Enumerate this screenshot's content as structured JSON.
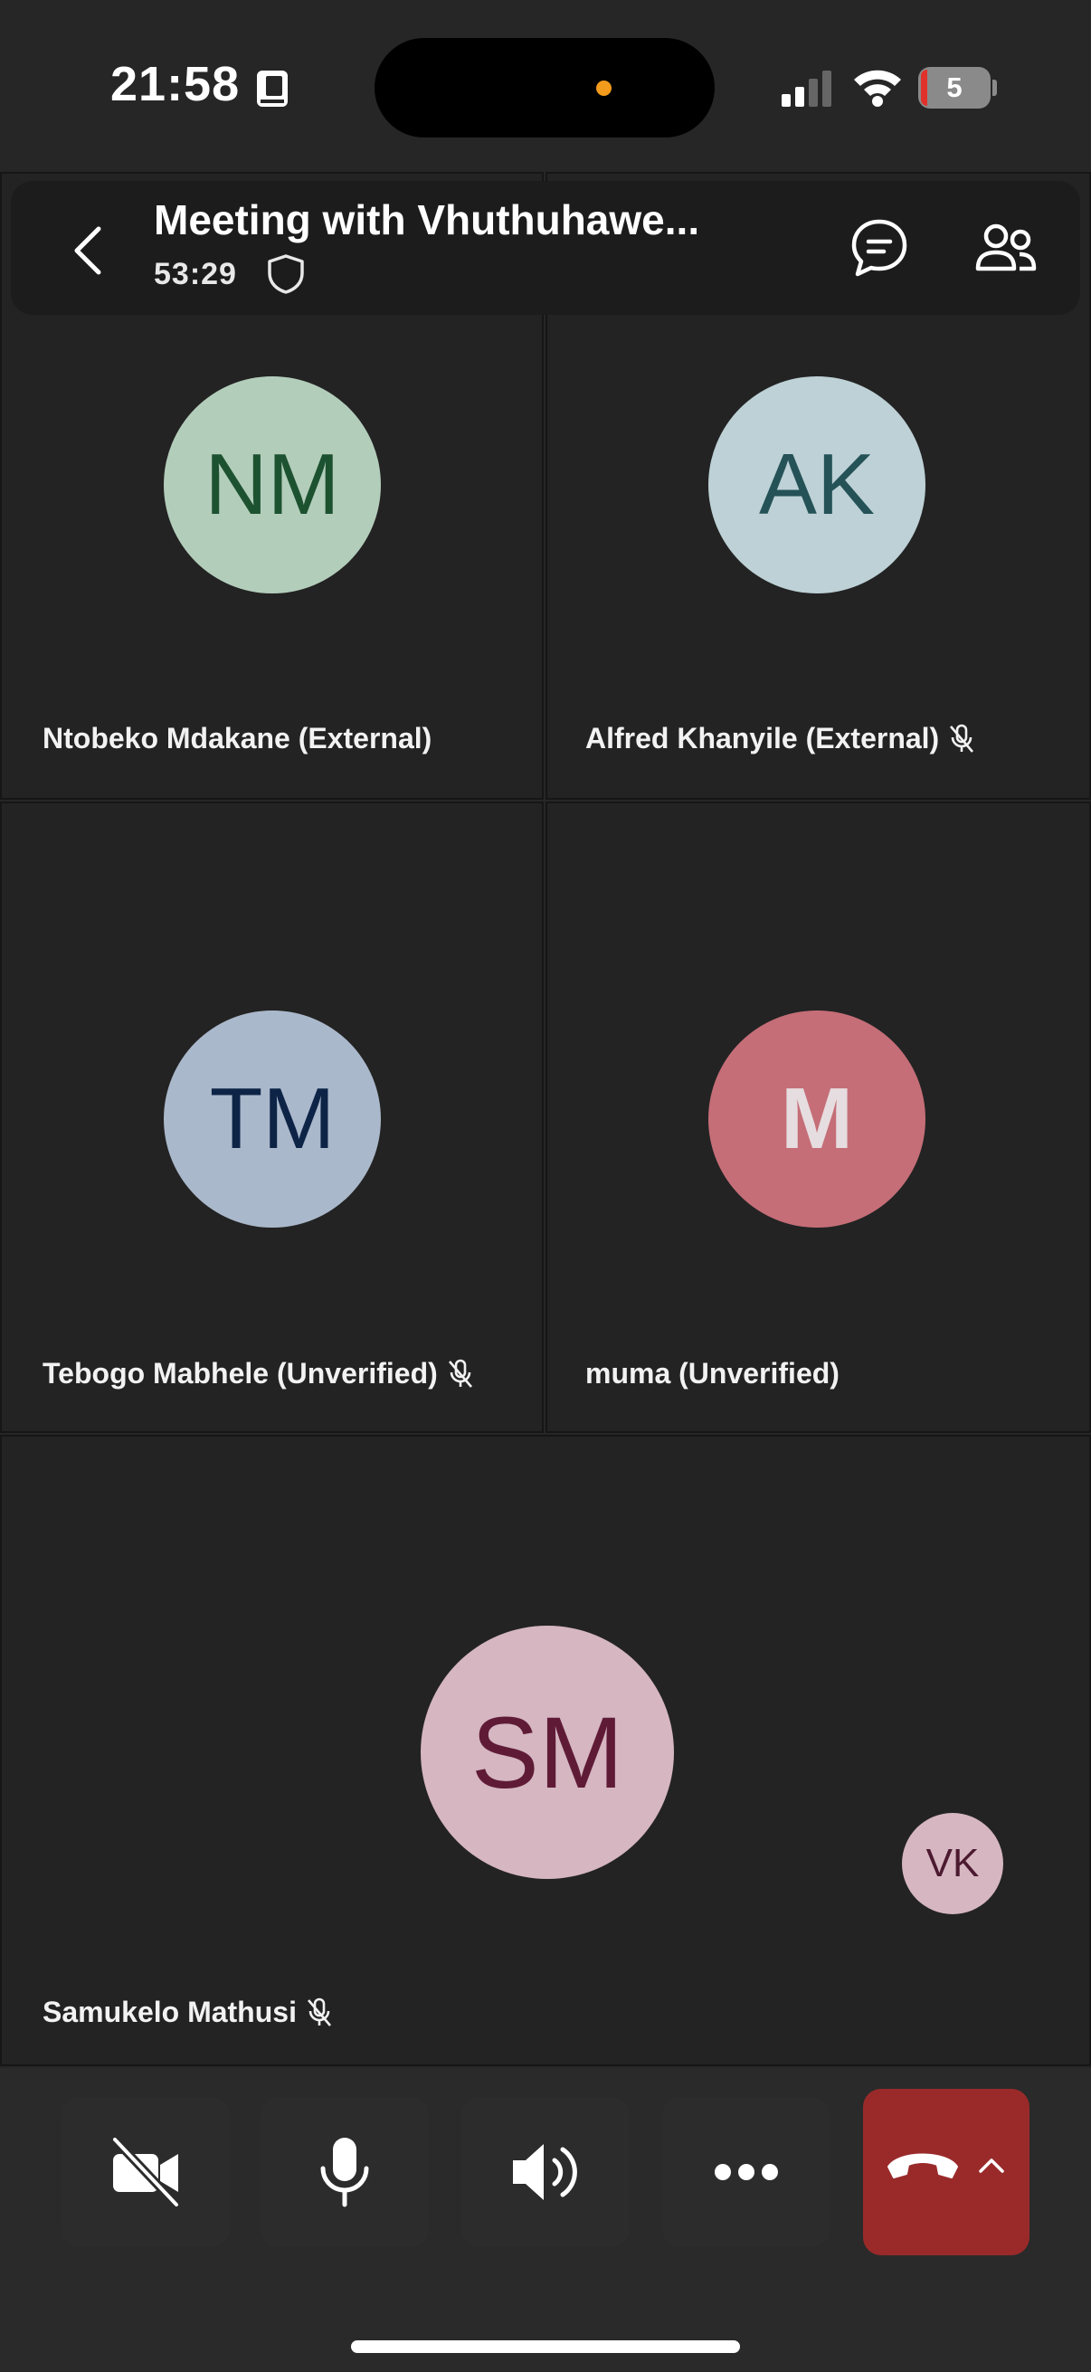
{
  "status_bar": {
    "time": "21:58",
    "battery": "5"
  },
  "meeting": {
    "title": "Meeting with Vhuthuhawe...",
    "timer": "53:29"
  },
  "participants": [
    {
      "initials": "NM",
      "name": "Ntobeko Mdakane (External)",
      "muted": false,
      "avatar_bg": "#b3cdbb",
      "avatar_fg": "#1d5230"
    },
    {
      "initials": "AK",
      "name": "Alfred Khanyile (External)",
      "muted": true,
      "avatar_bg": "#bdd1d6",
      "avatar_fg": "#245257"
    },
    {
      "initials": "TM",
      "name": "Tebogo Mabhele (Unverified)",
      "muted": true,
      "avatar_bg": "#aab8cb",
      "avatar_fg": "#0d2447"
    },
    {
      "initials": "M",
      "name": "muma (Unverified)",
      "muted": false,
      "avatar_bg": "#c56e78",
      "avatar_fg": "#e6dde0"
    },
    {
      "initials": "SM",
      "name": "Samukelo Mathusi",
      "muted": true,
      "avatar_bg": "#d5b6c1",
      "avatar_fg": "#5f1b36"
    }
  ],
  "self_view": {
    "initials": "VK",
    "avatar_bg": "#d5b6c1",
    "avatar_fg": "#4c1a30"
  },
  "controls": {
    "icons": [
      "video-off-icon",
      "microphone-icon",
      "speaker-icon",
      "more-icon",
      "hang-up-icon",
      "chevron-up-icon"
    ],
    "hangup_color": "#9a2a2a"
  }
}
